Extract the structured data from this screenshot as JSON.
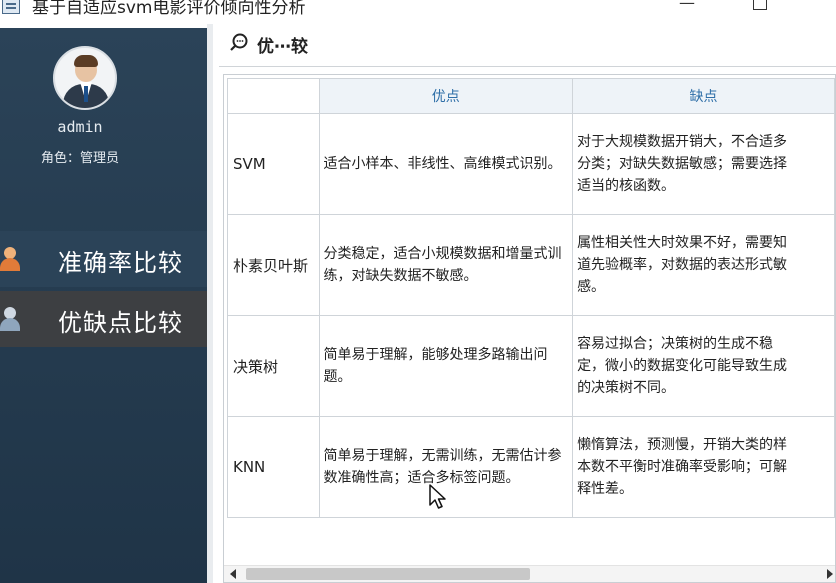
{
  "window": {
    "title": "基于自适应svm电影评价倾向性分析",
    "min_label": "—"
  },
  "sidebar": {
    "username": "admin",
    "role": "角色：管理员",
    "items": [
      {
        "label": "准确率比较",
        "icon": "user-orange-icon"
      },
      {
        "label": "优缺点比较",
        "icon": "user-gray-icon",
        "active": true
      }
    ]
  },
  "page": {
    "title": "优⋯较"
  },
  "table": {
    "headers": [
      "优点",
      "缺点"
    ],
    "rows": [
      {
        "name": "SVM",
        "pro": "适合小样本、非线性、高维模式识别。",
        "con": [
          "对于大规模数据开销大，不合适多",
          "分类；对缺失数据敏感；需要选择",
          "适当的核函数。"
        ]
      },
      {
        "name": "朴素贝叶斯",
        "pro": "分类稳定，适合小规模数据和增量式训练，对缺失数据不敏感。",
        "con": [
          "属性相关性大时效果不好，需要知",
          "道先验概率，对数据的表达形式敏",
          "感。"
        ]
      },
      {
        "name": "决策树",
        "pro": "简单易于理解，能够处理多路输出问题。",
        "con": [
          "容易过拟合；决策树的生成不稳",
          "定，微小的数据变化可能导致生成",
          "的决策树不同。"
        ]
      },
      {
        "name": "KNN",
        "pro": "简单易于理解，无需训练，无需估计参数准确性高；适合多标签问题。",
        "con": [
          "懒惰算法，预测慢，开销大类的样",
          "本数不平衡时准确率受影响；可解",
          "释性差。"
        ]
      }
    ]
  },
  "colors": {
    "sidebar_bg": "#2b4358",
    "active_item_bg": "#3d3f42",
    "header_text": "#2f6fa8"
  }
}
